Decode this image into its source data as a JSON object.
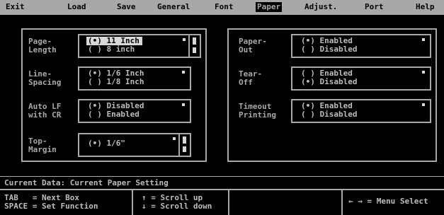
{
  "menu": [
    "Exit",
    "Load",
    "Save",
    "General",
    "Font",
    "Paper",
    "Adjust.",
    "Port",
    "Help"
  ],
  "left_fields": [
    {
      "label": "Page-\nLength",
      "options": [
        "(•) 11 Inch",
        "( ) 8 inch"
      ],
      "selected_index": 0,
      "scrollable": true
    },
    {
      "label": "Line-\nSpacing",
      "options": [
        "(•) 1/6 Inch",
        "( ) 1/8 Inch"
      ],
      "selected_index": -1,
      "scrollable": false
    },
    {
      "label": "Auto LF\nwith CR",
      "options": [
        "(•) Disabled",
        "( ) Enabled"
      ],
      "selected_index": -1,
      "scrollable": false
    },
    {
      "label": "Top-\nMargin",
      "options": [
        "(•) 1/6\""
      ],
      "selected_index": -1,
      "scrollable": true
    }
  ],
  "right_fields": [
    {
      "label": "Paper-\nOut",
      "options": [
        "(•) Enabled",
        "( ) Disabled"
      ]
    },
    {
      "label": "Tear-\nOff",
      "options": [
        "( ) Enabled",
        "(•) Disabled"
      ]
    },
    {
      "label": "Timeout\nPrinting",
      "options": [
        "(•) Enabled",
        "( ) Disabled"
      ]
    }
  ],
  "status": "Current Data: Current Paper Setting",
  "help": {
    "tab_line": "TAB   = Next Box",
    "space_line": "SPACE = Set Function",
    "scroll_up": "↑ = Scroll up",
    "scroll_down": "↓ = Scroll down",
    "menu_select": "← → = Menu Select"
  }
}
